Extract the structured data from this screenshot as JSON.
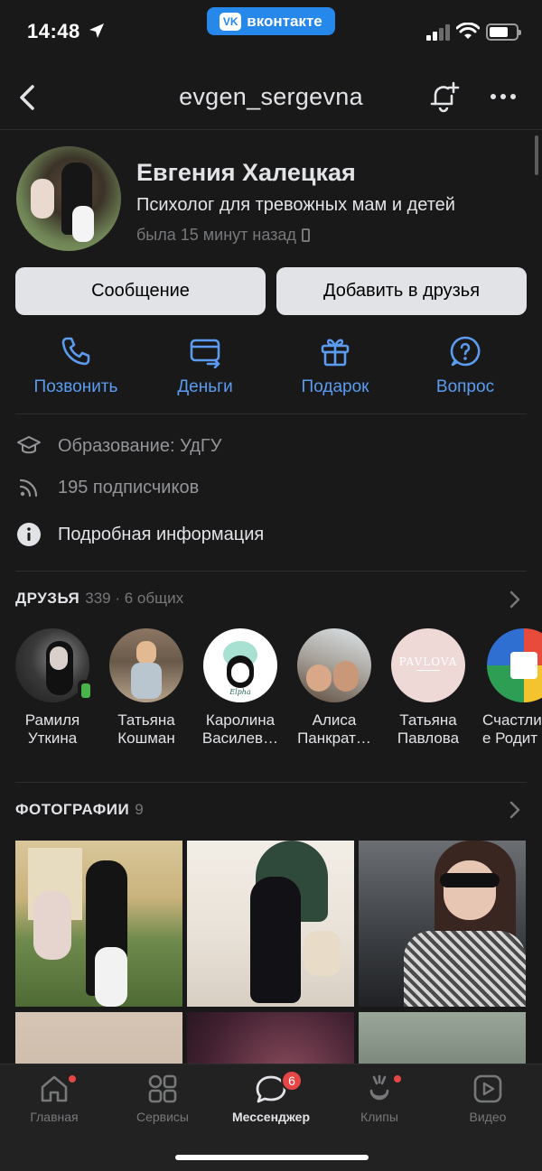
{
  "status_bar": {
    "time": "14:48",
    "app_pill": "вконтакте",
    "app_logo": "VK"
  },
  "header": {
    "title": "evgen_sergevna"
  },
  "profile": {
    "name": "Евгения Халецкая",
    "status": "Психолог для тревожных мам и детей",
    "last_seen": "была 15 минут назад"
  },
  "buttons": {
    "message": "Сообщение",
    "add_friend": "Добавить в друзья"
  },
  "actions": [
    {
      "label": "Позвонить",
      "icon": "phone-icon"
    },
    {
      "label": "Деньги",
      "icon": "money-transfer-icon"
    },
    {
      "label": "Подарок",
      "icon": "gift-icon"
    },
    {
      "label": "Вопрос",
      "icon": "question-icon"
    }
  ],
  "info": {
    "education": "Образование: УдГУ",
    "subscribers": "195 подписчиков",
    "details": "Подробная информация"
  },
  "friends": {
    "header": "ДРУЗЬЯ",
    "count": "339 · 6 общих",
    "items": [
      {
        "line1": "Рамиля",
        "line2": "Уткина"
      },
      {
        "line1": "Татьяна",
        "line2": "Кошман"
      },
      {
        "line1": "Каролина",
        "line2": "Василев…"
      },
      {
        "line1": "Алиса",
        "line2": "Панкрат…"
      },
      {
        "line1": "Татьяна",
        "line2": "Павлова"
      },
      {
        "line1": "Счастли",
        "line2": "е Родит"
      }
    ],
    "logo_texts": {
      "pavlova": "PAVLOVA",
      "elpha": "Elpha"
    }
  },
  "photos": {
    "header": "ФОТОГРАФИИ",
    "count": "9"
  },
  "tabbar": {
    "home": "Главная",
    "services": "Сервисы",
    "messenger": "Мессенджер",
    "messenger_badge": "6",
    "clips": "Клипы",
    "video": "Видео"
  },
  "colors": {
    "background": "#19191a",
    "accent": "#5b9cf1",
    "button_bg": "#e1e3e6",
    "online": "#4bb34b",
    "notification": "#e64646"
  }
}
